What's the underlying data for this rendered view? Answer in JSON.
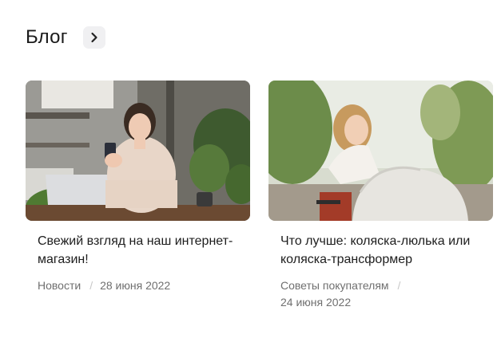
{
  "header": {
    "title": "Блог",
    "arrow_icon": "chevron-right-icon"
  },
  "posts": [
    {
      "title": "Свежий взгляд на наш интернет-магазин!",
      "category": "Новости",
      "date": "28 июня 2022",
      "image": "woman-with-phone-and-laptop-photo"
    },
    {
      "title": "Что лучше: коляска-люлька или коляска-трансформер",
      "category": "Советы покупателям",
      "date": "24 июня 2022",
      "image": "woman-with-white-stroller-photo"
    }
  ]
}
